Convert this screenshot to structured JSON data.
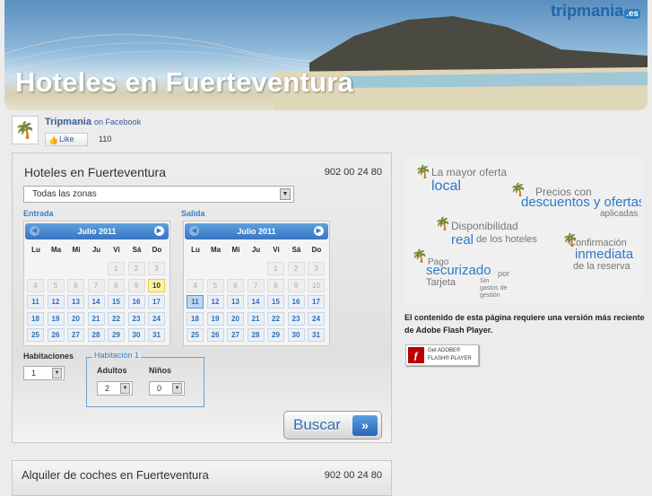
{
  "banner": {
    "title": "Hoteles en Fuerteventura",
    "logo": "tripmania",
    "logo_tld": ".es"
  },
  "facebook": {
    "page_name": "Tripmania",
    "on_facebook": "on Facebook",
    "like_label": "Like",
    "like_count": "110"
  },
  "search": {
    "title": "Hoteles en Fuerteventura",
    "phone": "902 00 24 80",
    "zone_value": "Todas las zonas",
    "entrada_label": "Entrada",
    "salida_label": "Salida",
    "cal_entrada": {
      "month": "Julio 2011",
      "today": "10",
      "selected": ""
    },
    "cal_salida": {
      "month": "Julio 2011",
      "today": "",
      "selected": "11"
    },
    "weekdays": [
      "Lu",
      "Ma",
      "Mi",
      "Ju",
      "Vi",
      "Sá",
      "Do"
    ],
    "weeks": [
      [
        "",
        "",
        "",
        "",
        "1",
        "2",
        "3"
      ],
      [
        "4",
        "5",
        "6",
        "7",
        "8",
        "9",
        "10"
      ],
      [
        "11",
        "12",
        "13",
        "14",
        "15",
        "16",
        "17"
      ],
      [
        "18",
        "19",
        "20",
        "21",
        "22",
        "23",
        "24"
      ],
      [
        "25",
        "26",
        "27",
        "28",
        "29",
        "30",
        "31"
      ]
    ],
    "habitaciones_label": "Habitaciones",
    "habitaciones_value": "1",
    "habitacion_legend": "Habitación 1",
    "adultos_label": "Adultos",
    "adultos_value": "2",
    "ninos_label": "Niños",
    "ninos_value": "0",
    "buscar_label": "Buscar"
  },
  "cars": {
    "title": "Alquiler de coches en Fuerteventura",
    "phone": "902 00 24 80"
  },
  "ad": {
    "line1_a": "La mayor oferta",
    "line1_b": "local",
    "line2_a": "Precios con",
    "line2_b": "descuentos y ofertas",
    "line2_c": "aplicadas",
    "line3_a": "Disponibilidad",
    "line3_b": "real",
    "line3_c": "de los hoteles",
    "line4_a": "Confirmación",
    "line4_b": "inmediata",
    "line4_c": "de la reserva",
    "line5_a": "Pago",
    "line5_b": "securizado",
    "line5_c": "por",
    "line5_d": "Tarjeta",
    "line5_e": "Sin gastos de gestión"
  },
  "flash": {
    "message": "El contenido de esta página requiere una versión más reciente de Adobe Flash Player.",
    "btn_line1": "Get ADOBE®",
    "btn_line2": "FLASH® PLAYER"
  }
}
